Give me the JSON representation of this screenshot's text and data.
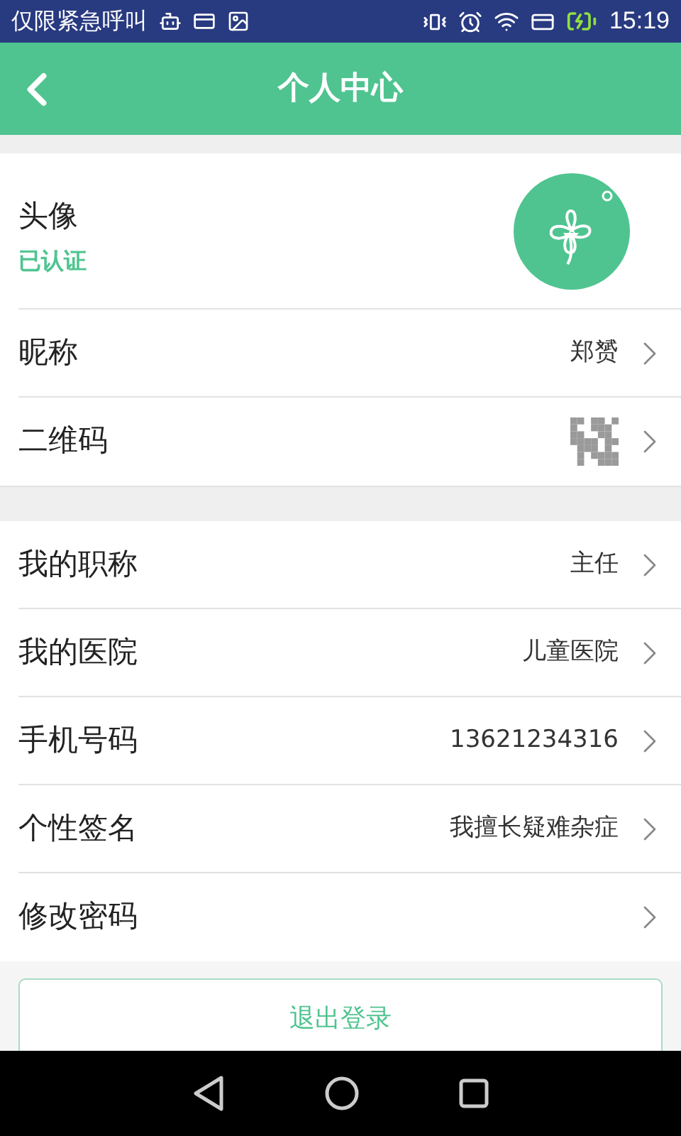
{
  "status_bar": {
    "carrier_text": "仅限紧急呼叫",
    "time": "15:19"
  },
  "header": {
    "title": "个人中心"
  },
  "profile": {
    "label": "头像",
    "verified_text": "已认证"
  },
  "sections": [
    {
      "rows": [
        {
          "kind": "text",
          "label": "昵称",
          "value": "郑赟"
        },
        {
          "kind": "qr",
          "label": "二维码"
        }
      ]
    },
    {
      "rows": [
        {
          "kind": "text",
          "label": "我的职称",
          "value": "主任"
        },
        {
          "kind": "text",
          "label": "我的医院",
          "value": "儿童医院"
        },
        {
          "kind": "text",
          "label": "手机号码",
          "value": "13621234316"
        },
        {
          "kind": "text",
          "label": "个性签名",
          "value": "我擅长疑难杂症"
        },
        {
          "kind": "plain",
          "label": "修改密码"
        }
      ]
    }
  ],
  "logout_button": "退出登录"
}
